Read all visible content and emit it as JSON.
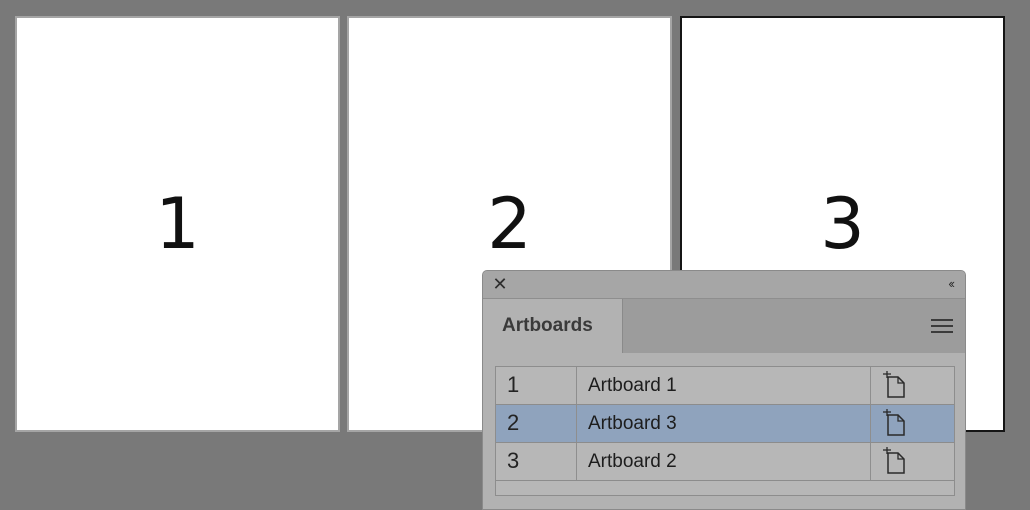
{
  "canvas": {
    "artboards": [
      {
        "number": "1",
        "selected": false
      },
      {
        "number": "2",
        "selected": false
      },
      {
        "number": "3",
        "selected": true
      }
    ]
  },
  "panel": {
    "close_symbol": "✕",
    "collapse_symbol": "‹‹",
    "tab_label": "Artboards",
    "menu_icon": "hamburger-menu-icon",
    "rows": [
      {
        "index": "1",
        "name": "Artboard 1",
        "selected": false,
        "icon": "artboard-options-icon"
      },
      {
        "index": "2",
        "name": "Artboard 3",
        "selected": true,
        "icon": "artboard-options-icon"
      },
      {
        "index": "3",
        "name": "Artboard 2",
        "selected": false,
        "icon": "artboard-options-icon"
      }
    ],
    "colors": {
      "selected_row": "#8fa3bd",
      "canvas_background": "#797979"
    }
  }
}
